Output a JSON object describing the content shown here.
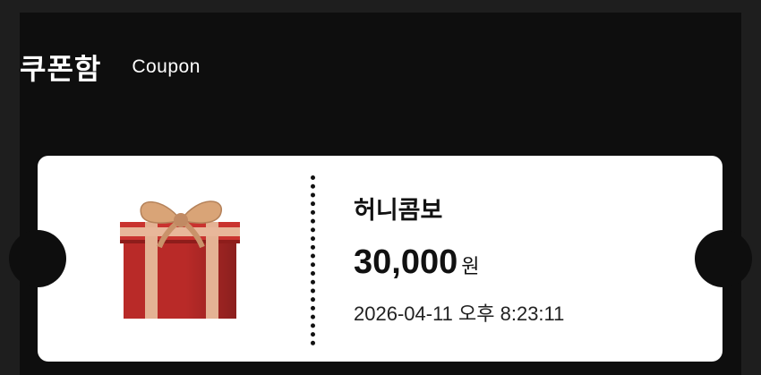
{
  "header": {
    "title_ko": "쿠폰함",
    "title_en": "Coupon"
  },
  "coupon": {
    "image_icon": "gift-box-icon",
    "name": "허니콤보",
    "amount": "30,000",
    "unit": "원",
    "datetime": "2026-04-11 오후 8:23:11"
  },
  "colors": {
    "background": "#0e0e0e",
    "card": "#ffffff",
    "gift_box": "#c0302e",
    "ribbon": "#e8b79a"
  }
}
